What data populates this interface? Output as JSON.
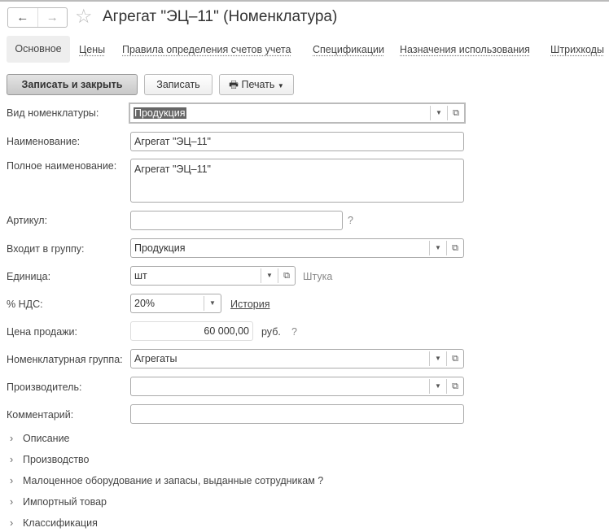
{
  "header": {
    "title": "Агрегат \"ЭЦ–11\" (Номенклатура)",
    "back": "←",
    "forward": "→",
    "favorite": "☆"
  },
  "tabs": [
    {
      "label": "Основное",
      "active": true
    },
    {
      "label": "Цены"
    },
    {
      "label": "Правила определения счетов учета"
    },
    {
      "label": "Спецификации"
    },
    {
      "label": "Назначения использования"
    },
    {
      "label": "Штрихкоды"
    }
  ],
  "toolbar": {
    "save_close": "Записать и закрыть",
    "save": "Записать",
    "print": "Печать"
  },
  "fields": {
    "kind": {
      "label": "Вид номенклатуры:",
      "value": "Продукция"
    },
    "name": {
      "label": "Наименование:",
      "value": "Агрегат \"ЭЦ–11\""
    },
    "full_name": {
      "label": "Полное наименование:",
      "value": "Агрегат \"ЭЦ–11\""
    },
    "article": {
      "label": "Артикул:",
      "value": "",
      "help": "?"
    },
    "group": {
      "label": "Входит в группу:",
      "value": "Продукция"
    },
    "unit": {
      "label": "Единица:",
      "value": "шт",
      "hint": "Штука"
    },
    "vat": {
      "label": "% НДС:",
      "value": "20%",
      "link": "История"
    },
    "price": {
      "label": "Цена продажи:",
      "value": "60 000,00",
      "currency": "руб.",
      "help": "?"
    },
    "nom_group": {
      "label": "Номенклатурная группа:",
      "value": "Агрегаты"
    },
    "manufacturer": {
      "label": "Производитель:",
      "value": ""
    },
    "comment": {
      "label": "Комментарий:",
      "value": ""
    }
  },
  "groups": [
    {
      "label": "Описание"
    },
    {
      "label": "Производство"
    },
    {
      "label": "Малоценное оборудование и запасы, выданные сотрудникам",
      "help": "?"
    },
    {
      "label": "Импортный товар"
    },
    {
      "label": "Классификация"
    }
  ]
}
